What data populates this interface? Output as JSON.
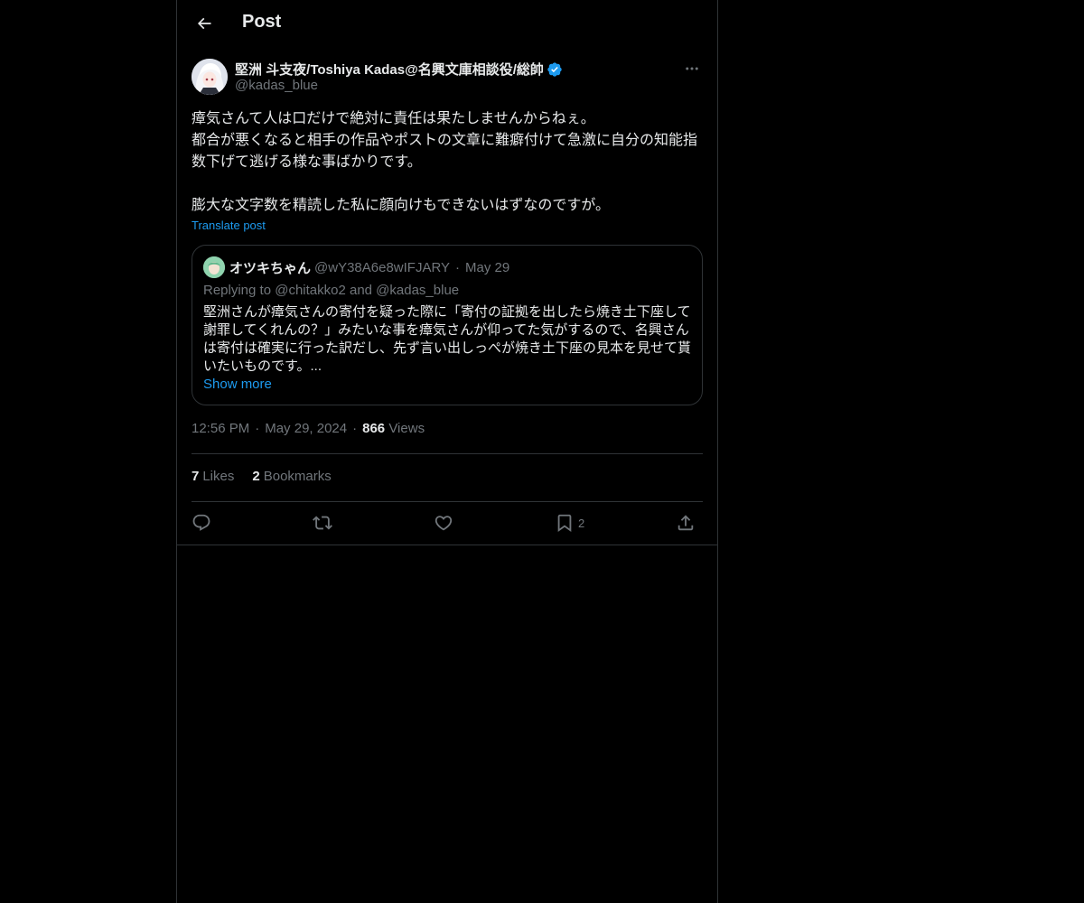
{
  "header": {
    "title": "Post",
    "back_icon": "arrow-left-icon"
  },
  "post": {
    "author_name": "堅洲 斗支夜/Toshiya Kadas@名興文庫相談役/総帥",
    "author_handle": "@kadas_blue",
    "verified": true,
    "text": "瘴気さんて人は口だけで絶対に責任は果たしませんからねぇ。\n都合が悪くなると相手の作品やポストの文章に難癖付けて急激に自分の知能指数下げて逃げる様な事ばかりです。\n\n膨大な文字数を精読した私に顔向けもできないはずなのですが。",
    "translate_label": "Translate post",
    "more_icon": "more-horizontal-icon"
  },
  "quote": {
    "author_name": "オツキちゃん",
    "author_handle": "@wY38A6e8wIFJARY",
    "dot": "·",
    "date": "May 29",
    "replying_to": "Replying to @chitakko2 and @kadas_blue",
    "text": "堅洲さんが瘴気さんの寄付を疑った際に「寄付の証拠を出したら焼き土下座して謝罪してくれんの？」みたいな事を瘴気さんが仰ってた気がするので、名興さんは寄付は確実に行った訳だし、先ず言い出しっぺが焼き土下座の見本を見せて貰いたいものです。...",
    "show_more_label": "Show more"
  },
  "meta": {
    "time": "12:56 PM",
    "date": "May 29, 2024",
    "views_count": "866",
    "views_label": "Views",
    "sep": "·"
  },
  "stats": {
    "likes_count": "7",
    "likes_label": "Likes",
    "bookmarks_count": "2",
    "bookmarks_label": "Bookmarks"
  },
  "actions": {
    "reply_icon": "reply-icon",
    "repost_icon": "repost-icon",
    "like_icon": "heart-icon",
    "bookmark_icon": "bookmark-icon",
    "bookmark_count": "2",
    "share_icon": "share-icon"
  },
  "colors": {
    "background": "#000000",
    "text": "#e7e9ea",
    "muted": "#71767b",
    "accent": "#1d9bf0",
    "border": "#2f3336"
  }
}
